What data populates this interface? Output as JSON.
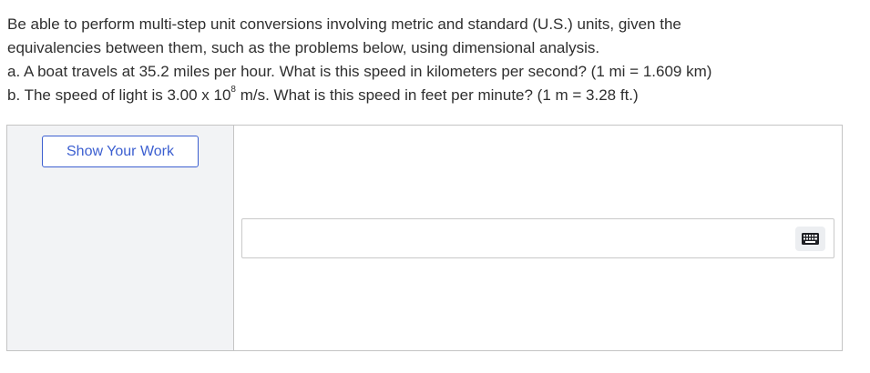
{
  "question": {
    "line1": "Be able to perform multi-step unit conversions involving metric and standard (U.S.) units, given the",
    "line2": "equivalencies between them, such as the problems below, using dimensional analysis.",
    "line3": "a. A boat travels at 35.2 miles per hour. What is this speed in kilometers per second? (1 mi = 1.609 km)",
    "line4_before": "b. The speed of light is 3.00 x 10",
    "line4_exponent": "8",
    "line4_after": " m/s. What is this speed in feet per minute? (1 m = 3.28 ft.)"
  },
  "work_panel": {
    "show_work_label": "Show Your Work"
  },
  "answer": {
    "value": "",
    "placeholder": ""
  },
  "icons": {
    "keyboard": "keyboard-icon"
  },
  "colors": {
    "accent": "#3c5fd0",
    "panel_bg": "#f2f3f5",
    "border": "#c4c4c4",
    "text": "#2f2f2f"
  }
}
